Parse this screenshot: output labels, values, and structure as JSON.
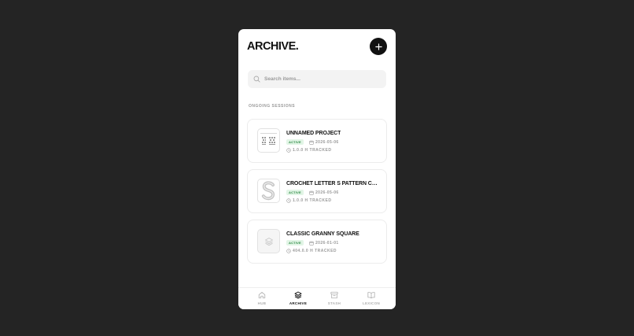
{
  "app": {
    "title": "ARCHIVE."
  },
  "header": {
    "add_icon": "plus-icon"
  },
  "search": {
    "placeholder": "Search items..."
  },
  "section": {
    "label": "ONGOING SESSIONS"
  },
  "sessions": [
    {
      "title": "UNNAMED PROJECT",
      "status": "ACTIVE",
      "date": "2026-05-06",
      "tracked": "1.0.0 H TRACKED",
      "thumb_icon": "pattern-chart-icon"
    },
    {
      "title": "CROCHET LETTER S PATTERN CHART",
      "status": "ACTIVE",
      "date": "2026-05-06",
      "tracked": "1.0.0 H TRACKED",
      "thumb_icon": "letter-s-icon"
    },
    {
      "title": "CLASSIC GRANNY SQUARE",
      "status": "ACTIVE",
      "date": "2026-01-01",
      "tracked": "404.0.0 H TRACKED",
      "thumb_icon": "layers-icon"
    }
  ],
  "nav": [
    {
      "label": "HUB",
      "icon": "home-icon",
      "active": false
    },
    {
      "label": "ARCHIVE",
      "icon": "layers-icon",
      "active": true
    },
    {
      "label": "STASH",
      "icon": "archive-box-icon",
      "active": false
    },
    {
      "label": "LEXICON",
      "icon": "book-icon",
      "active": false
    }
  ],
  "colors": {
    "background": "#242424",
    "accent": "#111111",
    "badge_bg": "#e2f5e6",
    "badge_text": "#2e8a45"
  }
}
